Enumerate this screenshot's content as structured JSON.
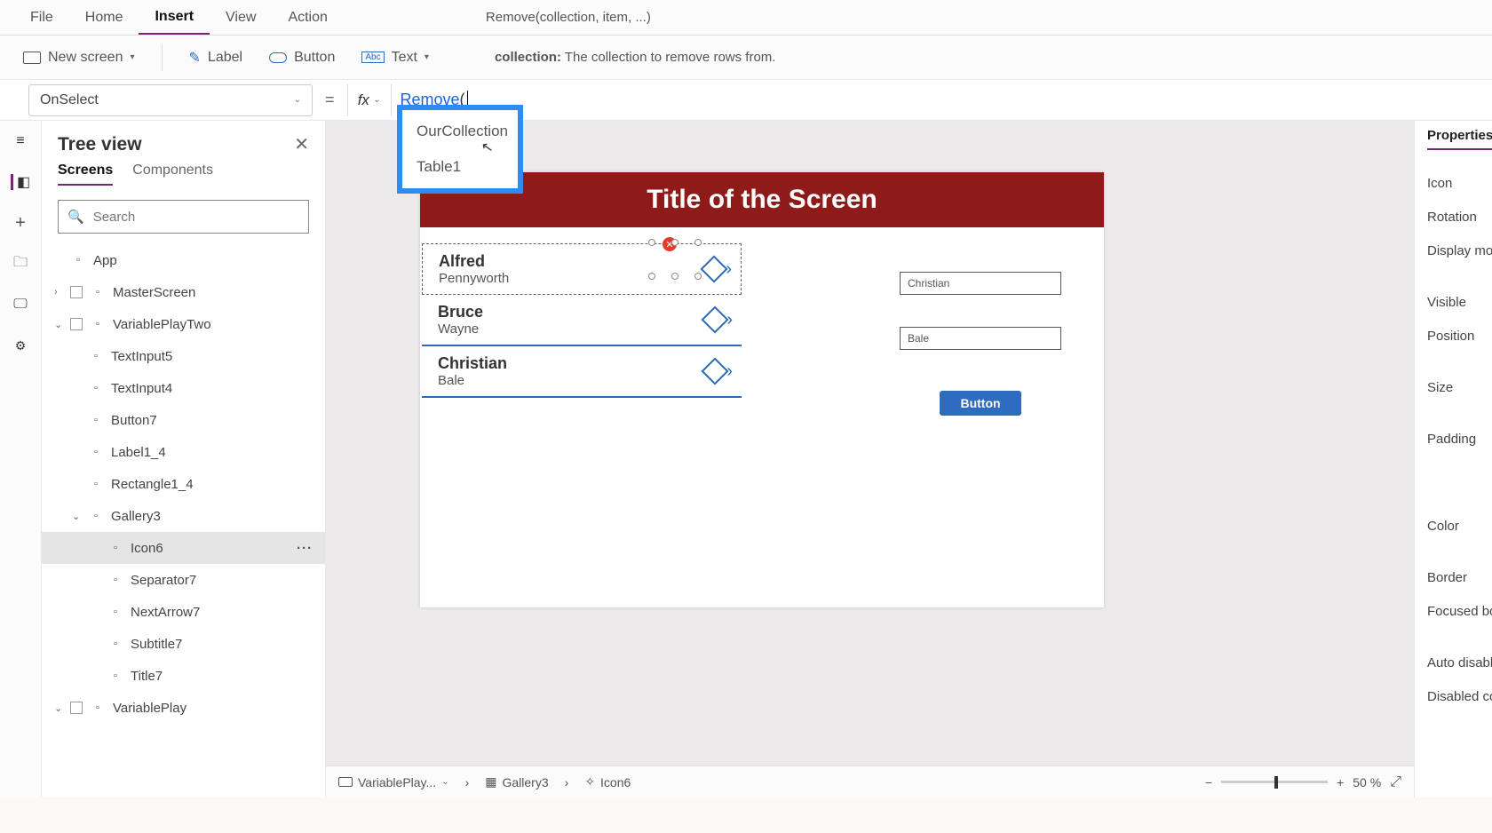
{
  "menu": {
    "file": "File",
    "home": "Home",
    "insert": "Insert",
    "view": "View",
    "action": "Action"
  },
  "ribbon": {
    "new_screen": "New screen",
    "label": "Label",
    "button": "Button",
    "text": "Text"
  },
  "signature": {
    "prefix": "Remove(",
    "bold_arg": "collection",
    "suffix": ", item, ...)"
  },
  "hint": {
    "bold": "collection:",
    "text": " The collection to remove rows from."
  },
  "prop_dropdown": "OnSelect",
  "fx_label": "fx",
  "formula": {
    "fn": "Remove",
    "paren": "("
  },
  "intellisense": {
    "items": [
      "OurCollection",
      "Table1"
    ]
  },
  "tree": {
    "title": "Tree view",
    "tabs": {
      "screens": "Screens",
      "components": "Components"
    },
    "search_placeholder": "Search",
    "nodes": [
      {
        "label": "App",
        "indent": 0,
        "chev": "",
        "icon": "app"
      },
      {
        "label": "MasterScreen",
        "indent": 0,
        "chev": "›",
        "icon": "screen"
      },
      {
        "label": "VariablePlayTwo",
        "indent": 0,
        "chev": "⌄",
        "icon": "screen"
      },
      {
        "label": "TextInput5",
        "indent": 1,
        "icon": "input"
      },
      {
        "label": "TextInput4",
        "indent": 1,
        "icon": "input"
      },
      {
        "label": "Button7",
        "indent": 1,
        "icon": "button"
      },
      {
        "label": "Label1_4",
        "indent": 1,
        "icon": "label"
      },
      {
        "label": "Rectangle1_4",
        "indent": 1,
        "icon": "rect"
      },
      {
        "label": "Gallery3",
        "indent": 1,
        "chev": "⌄",
        "icon": "gallery"
      },
      {
        "label": "Icon6",
        "indent": 2,
        "icon": "icon",
        "selected": true
      },
      {
        "label": "Separator7",
        "indent": 2,
        "icon": "sep"
      },
      {
        "label": "NextArrow7",
        "indent": 2,
        "icon": "arrow"
      },
      {
        "label": "Subtitle7",
        "indent": 2,
        "icon": "label"
      },
      {
        "label": "Title7",
        "indent": 2,
        "icon": "label"
      },
      {
        "label": "VariablePlay",
        "indent": 0,
        "chev": "⌄",
        "icon": "screen"
      }
    ]
  },
  "canvas": {
    "screen_title": "Title of the Screen",
    "gallery": [
      {
        "title": "Alfred",
        "sub": "Pennyworth"
      },
      {
        "title": "Bruce",
        "sub": "Wayne"
      },
      {
        "title": "Christian",
        "sub": "Bale"
      }
    ],
    "input1": "Christian",
    "input2": "Bale",
    "button_label": "Button"
  },
  "breadcrumb": {
    "screen": "VariablePlay...",
    "gallery": "Gallery3",
    "icon": "Icon6"
  },
  "zoom": {
    "value": "50",
    "unit": "%"
  },
  "props": {
    "tab": "Properties",
    "items": [
      "Icon",
      "Rotation",
      "Display mod",
      "",
      "Visible",
      "Position",
      "",
      "Size",
      "",
      "Padding",
      "",
      "",
      "",
      "Color",
      "",
      "Border",
      "Focused bo",
      "",
      "Auto disabl",
      "Disabled co"
    ]
  }
}
